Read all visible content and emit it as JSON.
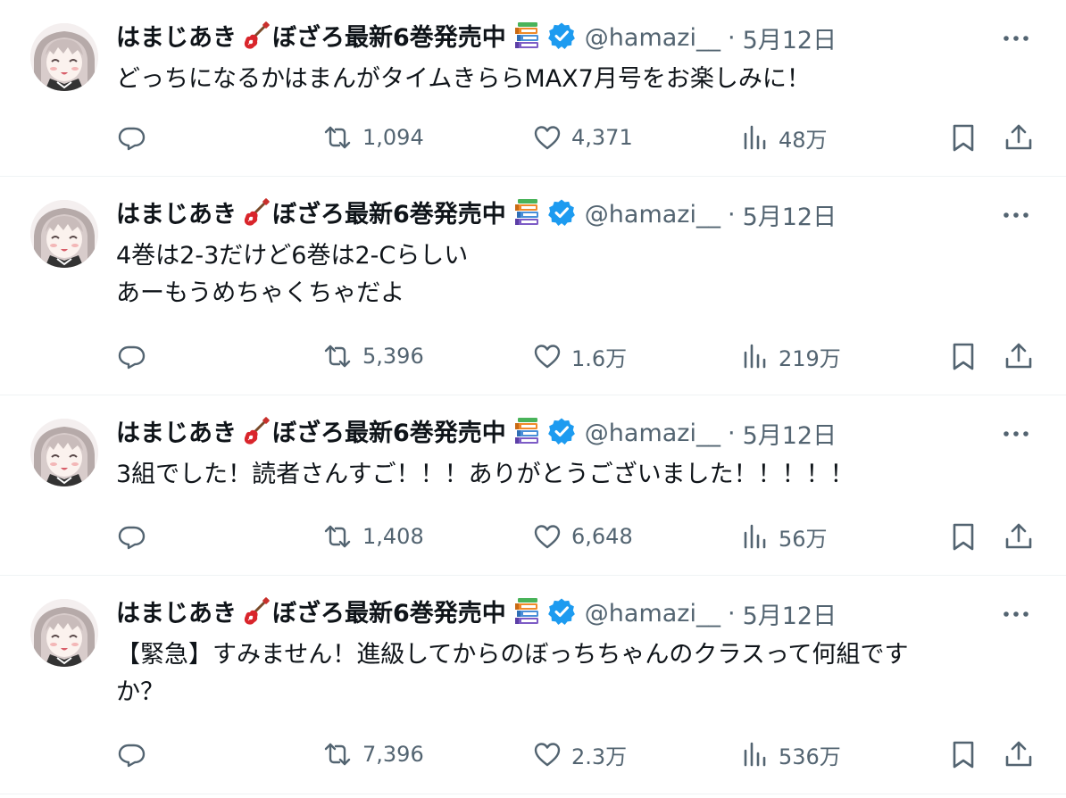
{
  "colors": {
    "text": "#0f1419",
    "muted": "#536471",
    "verified": "#1d9bf0",
    "divider": "#eff3f4"
  },
  "author": {
    "display_name_part1": "はまじあき",
    "display_name_part2": "ぼざろ最新6巻発売中",
    "handle": "@hamazi__",
    "separator": "·",
    "name_emoji_1": "guitar-icon",
    "name_emoji_2": "books-icon",
    "badge": "verified-icon"
  },
  "tweets": [
    {
      "date": "5月12日",
      "text": "どっちになるかはまんがタイムきららMAX7月号をお楽しみに！",
      "retweets": "1,094",
      "likes": "4,371",
      "views": "48万"
    },
    {
      "date": "5月12日",
      "text": "4巻は2-3だけど6巻は2-Cらしい\nあーもうめちゃくちゃだよ",
      "retweets": "5,396",
      "likes": "1.6万",
      "views": "219万"
    },
    {
      "date": "5月12日",
      "text": "3組でした！読者さんすご！！！ありがとうございました！！！！！",
      "retweets": "1,408",
      "likes": "6,648",
      "views": "56万"
    },
    {
      "date": "5月12日",
      "text": "【緊急】すみません！進級してからのぼっちちゃんのクラスって何組です\nか？",
      "retweets": "7,396",
      "likes": "2.3万",
      "views": "536万"
    }
  ]
}
